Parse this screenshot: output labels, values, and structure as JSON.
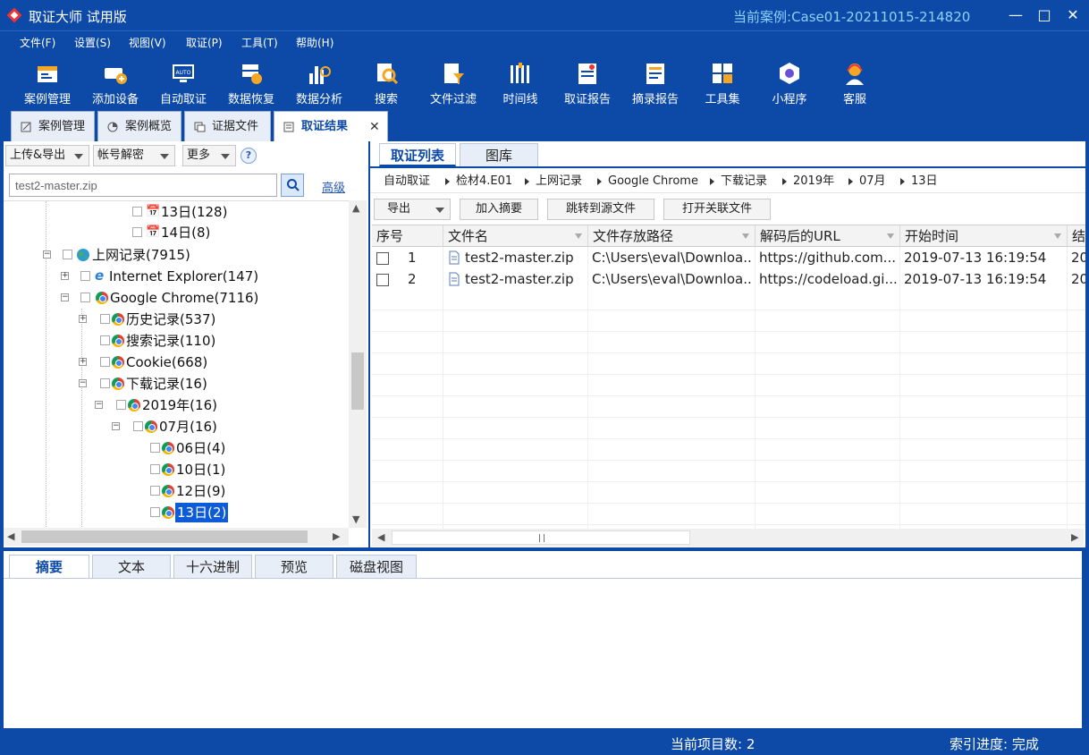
{
  "app": {
    "title": "取证大师 试用版",
    "case_label": "当前案例:",
    "case_name": "Case01-20211015-214820",
    "minimize": "—",
    "maximize": "□",
    "close": "✕"
  },
  "menu": [
    "文件(F)",
    "设置(S)",
    "视图(V)",
    "取证(P)",
    "工具(T)",
    "帮助(H)"
  ],
  "toolbar": [
    {
      "label": "案例管理",
      "icon": "case-management-icon"
    },
    {
      "label": "添加设备",
      "icon": "add-device-icon"
    },
    {
      "label": "自动取证",
      "icon": "auto-forensics-icon"
    },
    {
      "label": "数据恢复",
      "icon": "data-recovery-icon"
    },
    {
      "label": "数据分析",
      "icon": "data-analysis-icon"
    },
    {
      "label": "搜索",
      "icon": "search-icon"
    },
    {
      "label": "文件过滤",
      "icon": "file-filter-icon"
    },
    {
      "label": "时间线",
      "icon": "timeline-icon"
    },
    {
      "label": "取证报告",
      "icon": "forensics-report-icon"
    },
    {
      "label": "摘录报告",
      "icon": "excerpt-report-icon"
    },
    {
      "label": "工具集",
      "icon": "toolset-icon"
    },
    {
      "label": "小程序",
      "icon": "mini-program-icon"
    },
    {
      "label": "客服",
      "icon": "customer-service-icon"
    }
  ],
  "doc_tabs": [
    "案例管理",
    "案例概览",
    "证据文件",
    "取证结果"
  ],
  "doc_tab_close": "✕",
  "left": {
    "upload_export": "上传&导出",
    "account_decrypt": "帐号解密",
    "more": "更多",
    "help": "?",
    "search_value": "test2-master.zip",
    "advanced": "高级"
  },
  "tree": [
    {
      "label": "13日(128)"
    },
    {
      "label": "14日(8)"
    },
    {
      "label": "上网记录(7915)"
    },
    {
      "label": "Internet Explorer(147)"
    },
    {
      "label": "Google Chrome(7116)"
    },
    {
      "label": "历史记录(537)"
    },
    {
      "label": "搜索记录(110)"
    },
    {
      "label": "Cookie(668)"
    },
    {
      "label": "下载记录(16)"
    },
    {
      "label": "2019年(16)"
    },
    {
      "label": "07月(16)"
    },
    {
      "label": "06日(4)"
    },
    {
      "label": "10日(1)"
    },
    {
      "label": "12日(9)"
    },
    {
      "label": "13日(2)",
      "selected": true
    }
  ],
  "right": {
    "tabs": [
      "取证列表",
      "图库"
    ],
    "breadcrumb": [
      "自动取证",
      "检材4.E01",
      "上网记录",
      "Google Chrome",
      "下载记录",
      "2019年",
      "07月",
      "13日"
    ],
    "actions": {
      "export": "导出",
      "add_excerpt": "加入摘要",
      "jump_source": "跳转到源文件",
      "open_related": "打开关联文件"
    },
    "columns": [
      "序号",
      "文件名",
      "文件存放路径",
      "解码后的URL",
      "开始时间",
      "结"
    ],
    "rows": [
      {
        "num": "1",
        "name": "test2-master.zip",
        "path": "C:\\Users\\eval\\Downloa...",
        "url": "https://github.com...",
        "start": "2019-07-13 16:19:54",
        "end": "20"
      },
      {
        "num": "2",
        "name": "test2-master.zip",
        "path": "C:\\Users\\eval\\Downloa...",
        "url": "https://codeload.gi...",
        "start": "2019-07-13 16:19:54",
        "end": "20"
      }
    ]
  },
  "bottom_tabs": [
    "摘要",
    "文本",
    "十六进制",
    "预览",
    "磁盘视图"
  ],
  "status": {
    "count": "当前项目数: 2",
    "index": "索引进度: 完成"
  },
  "colors": {
    "brand": "#0d4aa8",
    "accent_text": "#8fd0ff",
    "selected": "#0d5bd6"
  }
}
